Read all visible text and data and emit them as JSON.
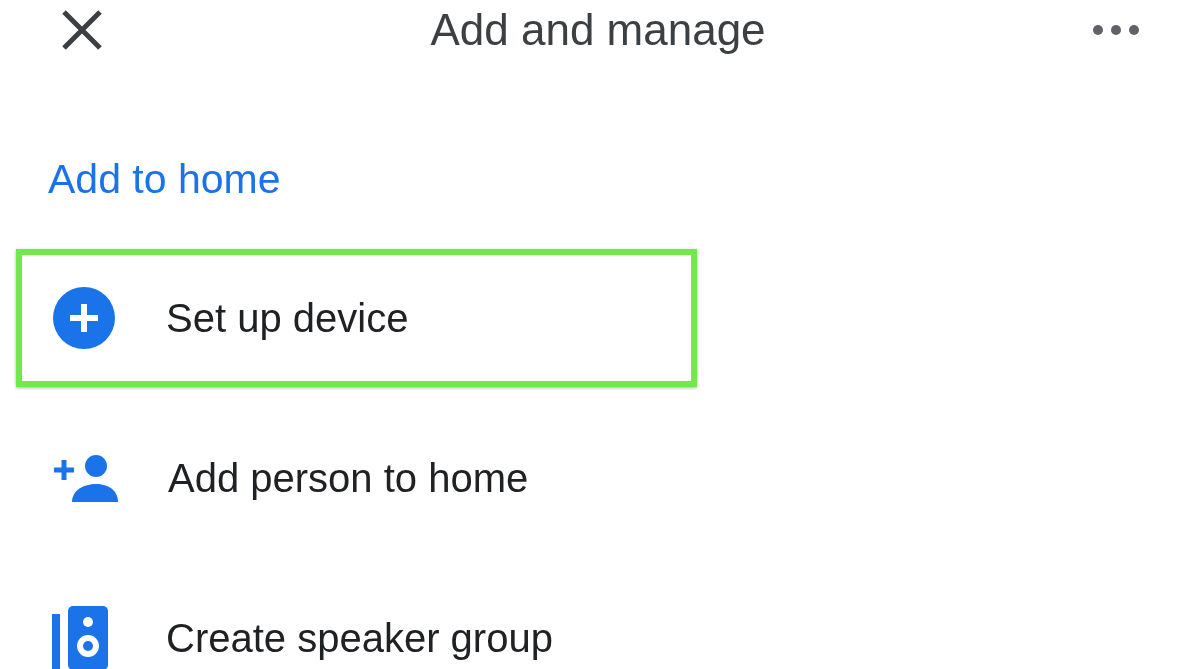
{
  "header": {
    "title": "Add and manage"
  },
  "section": {
    "title": "Add to home"
  },
  "items": [
    {
      "kind": "device",
      "label": "Set up device",
      "highlighted": true
    },
    {
      "kind": "person",
      "label": "Add person to home",
      "highlighted": false
    },
    {
      "kind": "speaker",
      "label": "Create speaker group",
      "highlighted": false
    }
  ]
}
